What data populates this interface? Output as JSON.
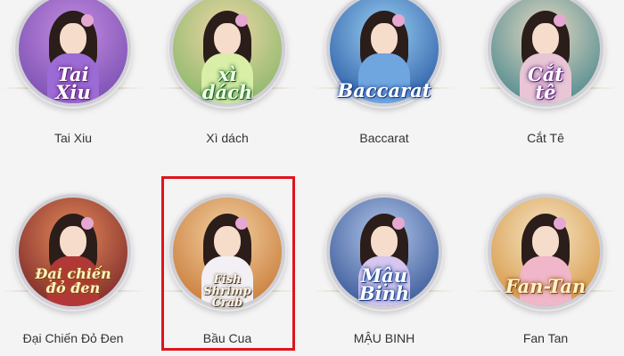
{
  "games": [
    {
      "id": "tai-xiu",
      "art_title_lines": [
        "Tai",
        "Xiu"
      ],
      "label": "Tai Xiu",
      "bg": [
        "#7a4fb3",
        "#c58ee0"
      ],
      "dress": "#9d6bd6",
      "title_style": "purple"
    },
    {
      "id": "xi-dach",
      "art_title_lines": [
        "xì",
        "dách"
      ],
      "label": "Xì dách",
      "bg": [
        "#8bb86a",
        "#f0d7a8"
      ],
      "dress": "#d9efa8",
      "title_style": "green"
    },
    {
      "id": "baccarat",
      "art_title_lines": [
        "Baccarat"
      ],
      "label": "Baccarat",
      "bg": [
        "#2e5fa8",
        "#9ad0f2"
      ],
      "dress": "#6fa6e0",
      "title_style": "blue"
    },
    {
      "id": "cat-te",
      "art_title_lines": [
        "Cắt",
        "tê"
      ],
      "label": "Cắt Tê",
      "bg": [
        "#4f8b8f",
        "#e7d9c2"
      ],
      "dress": "#e8c6d6",
      "title_style": "purple"
    },
    {
      "id": "dai-chien-do-den",
      "art_title_lines": [
        "Đại chiến",
        "đỏ đen"
      ],
      "label": "Đại Chiến Đỏ Đen",
      "bg": [
        "#7d2a2a",
        "#e68b5a"
      ],
      "dress": "#b23838",
      "title_style": "gold"
    },
    {
      "id": "bau-cua",
      "art_title_lines": [
        "Fish",
        "Shrimp",
        "Crab"
      ],
      "label": "Bầu Cua",
      "bg": [
        "#c97c3a",
        "#f3d2a4"
      ],
      "dress": "#f2f0f4",
      "title_style": "fish"
    },
    {
      "id": "mau-binh",
      "art_title_lines": [
        "Mậu",
        "Binh"
      ],
      "label": "MẬU BINH",
      "bg": [
        "#3a5a9a",
        "#b5c8ea"
      ],
      "dress": "#d7c6ef",
      "title_style": "blue"
    },
    {
      "id": "fan-tan",
      "art_title_lines": [
        "Fan-Tan"
      ],
      "label": "Fan Tan",
      "bg": [
        "#d79a4a",
        "#f6e6c6"
      ],
      "dress": "#f0b6c9",
      "title_style": "gold"
    }
  ],
  "highlighted_game": "Bầu Cua",
  "colors": {
    "highlight_border": "#e0141b",
    "page_bg": "#f4f4f4",
    "caption_text": "#333333"
  }
}
